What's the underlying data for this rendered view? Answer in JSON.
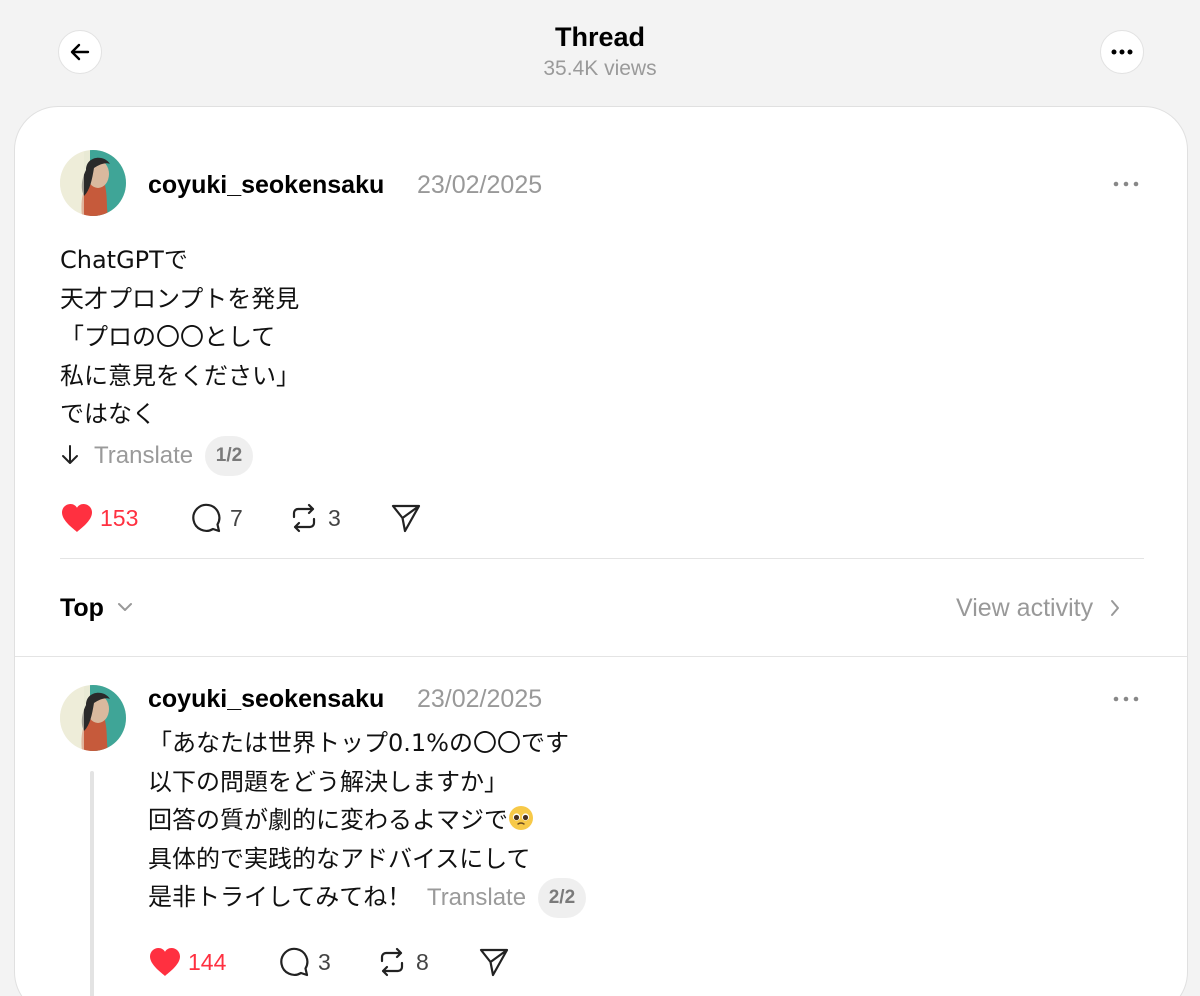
{
  "header": {
    "title": "Thread",
    "views": "35.4K views"
  },
  "posts": [
    {
      "username": "coyuki_seokensaku",
      "date": "23/02/2025",
      "lines": [
        "ChatGPTで",
        "天才プロンプトを発見",
        "「プロの〇〇として",
        "私に意見をください」",
        "ではなく"
      ],
      "translate_label": "Translate",
      "page_indicator": "1/2",
      "likes": "153",
      "comments": "7",
      "reposts": "3"
    },
    {
      "username": "coyuki_seokensaku",
      "date": "23/02/2025",
      "lines": [
        "「あなたは世界トップ0.1%の〇〇です",
        "以下の問題をどう解決しますか」",
        "回答の質が劇的に変わるよマジで",
        "具体的で実践的なアドバイスにして",
        "是非トライしてみてね！"
      ],
      "translate_label": "Translate",
      "page_indicator": "2/2",
      "likes": "144",
      "comments": "3",
      "reposts": "8"
    }
  ],
  "replies_bar": {
    "sort_label": "Top",
    "view_activity": "View activity"
  },
  "colors": {
    "like": "#ff3040",
    "muted": "#999999",
    "background": "#f3f3f3"
  },
  "icons": [
    "back-arrow-icon",
    "more-icon",
    "heart-icon",
    "comment-icon",
    "repost-icon",
    "share-icon",
    "chevron-down-icon",
    "chevron-right-icon",
    "pleading-face-emoji"
  ]
}
